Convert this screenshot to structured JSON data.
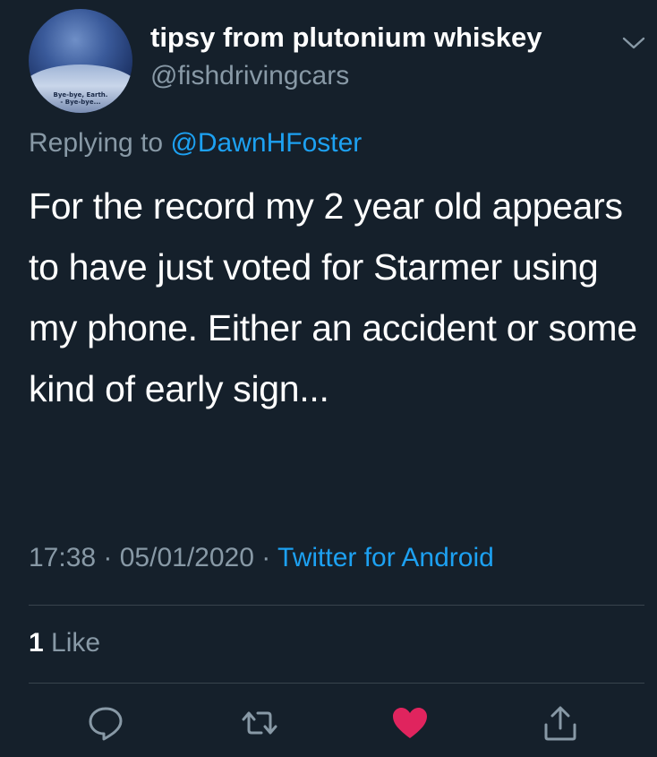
{
  "user": {
    "display_name": "tipsy from plutonium whiskey",
    "handle": "@fishdrivingcars",
    "avatar_caption": "Bye-bye, Earth.\n- Bye-bye..."
  },
  "reply": {
    "prefix": "Replying to ",
    "mention": "@DawnHFoster"
  },
  "tweet": {
    "text": "For the record my 2 year old appears to have just voted for Starmer using my phone. Either an accident or some kind of early sign..."
  },
  "meta": {
    "time": "17:38",
    "separator1": " · ",
    "date": "05/01/2020",
    "separator2": " · ",
    "source": "Twitter for Android"
  },
  "stats": {
    "likes_count": "1",
    "likes_label": "Like"
  },
  "actions": {
    "reply_icon": "comment-bubble-icon",
    "retweet_icon": "retweet-icon",
    "like_icon": "heart-filled-icon",
    "share_icon": "share-icon"
  },
  "colors": {
    "background": "#15202b",
    "text_primary": "#ffffff",
    "text_secondary": "#8899a6",
    "link": "#1da1f2",
    "like_active": "#e0245e",
    "divider": "#38444d"
  }
}
